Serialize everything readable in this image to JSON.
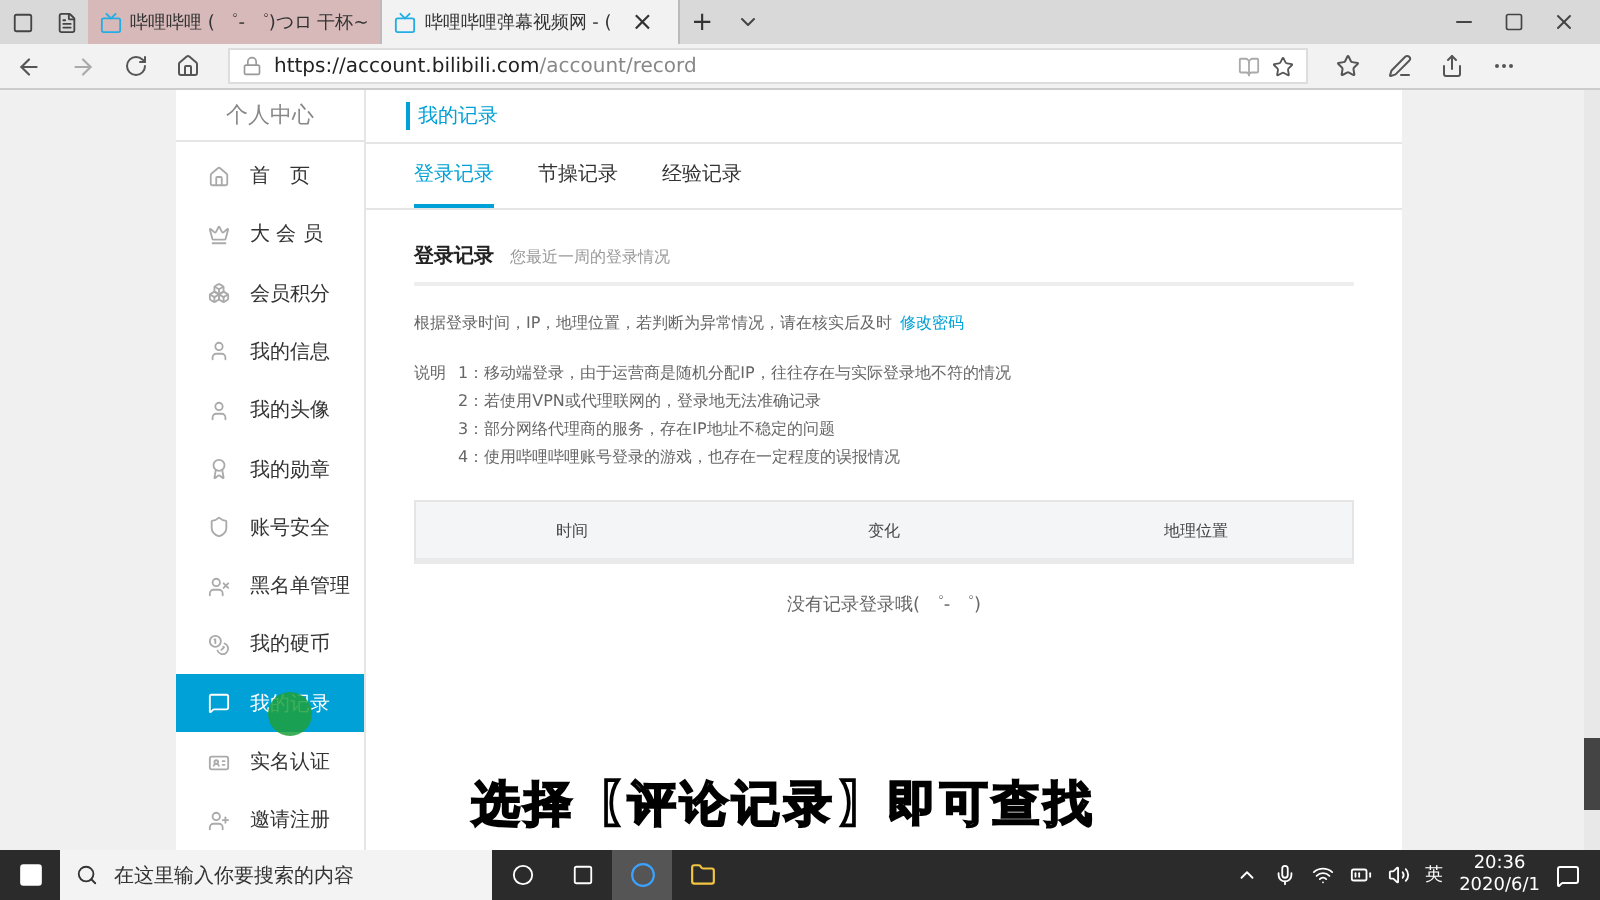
{
  "browser": {
    "tabs": [
      {
        "title": "哔哩哔哩 ( ゜- ゜)つロ 干杯~",
        "selected": false
      },
      {
        "title": "哔哩哔哩弹幕视频网 - (",
        "selected": true
      }
    ],
    "close_glyph": "×",
    "new_tab_glyph": "+",
    "url_host": "https://account.bilibili.com",
    "url_path": "/account/record"
  },
  "sidebar": {
    "title": "个人中心",
    "items": [
      {
        "label": "首　页",
        "selected": false
      },
      {
        "label": "大 会 员",
        "selected": false
      },
      {
        "label": "会员积分",
        "selected": false
      },
      {
        "label": "我的信息",
        "selected": false
      },
      {
        "label": "我的头像",
        "selected": false
      },
      {
        "label": "我的勋章",
        "selected": false
      },
      {
        "label": "账号安全",
        "selected": false
      },
      {
        "label": "黑名单管理",
        "selected": false
      },
      {
        "label": "我的硬币",
        "selected": false
      },
      {
        "label": "我的记录",
        "selected": true
      },
      {
        "label": "实名认证",
        "selected": false
      },
      {
        "label": "邀请注册",
        "selected": false
      }
    ]
  },
  "main": {
    "heading": "我的记录",
    "tabs": [
      {
        "label": "登录记录",
        "selected": true
      },
      {
        "label": "节操记录",
        "selected": false
      },
      {
        "label": "经验记录",
        "selected": false
      }
    ],
    "section_title": "登录记录",
    "section_subtitle": "您最近一周的登录情况",
    "intro": "根据登录时间，IP，地理位置，若判断为异常情况，请在核实后及时",
    "intro_link": "修改密码",
    "notes_label": "说明",
    "notes": [
      "1：移动端登录，由于运营商是随机分配IP，往往存在与实际登录地不符的情况",
      "2：若使用VPN或代理联网的，登录地无法准确记录",
      "3：部分网络代理商的服务，存在IP地址不稳定的问题",
      "4：使用哔哩哔哩账号登录的游戏，也存在一定程度的误报情况"
    ],
    "table": {
      "columns": [
        "时间",
        "变化",
        "地理位置"
      ]
    },
    "empty_text": "没有记录登录哦( ゜- ゜)"
  },
  "caption": "选择【评论记录】即可查找",
  "taskbar": {
    "search_placeholder": "在这里输入你要搜索的内容",
    "ime": "英",
    "time": "20:36",
    "date": "2020/6/1"
  }
}
